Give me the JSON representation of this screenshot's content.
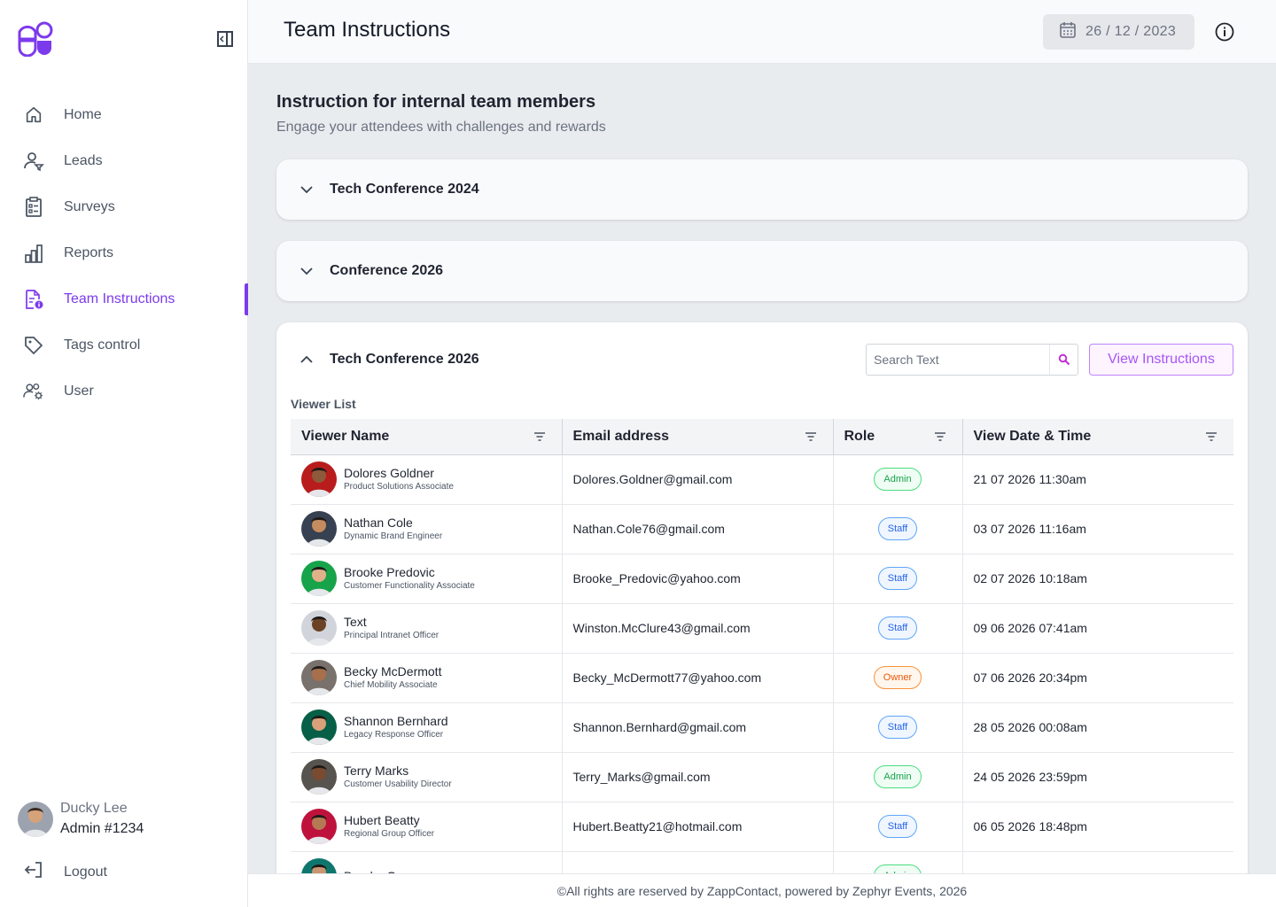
{
  "sidebar": {
    "items": [
      {
        "label": "Home",
        "icon": "home-icon"
      },
      {
        "label": "Leads",
        "icon": "leads-icon"
      },
      {
        "label": "Surveys",
        "icon": "clipboard-icon"
      },
      {
        "label": "Reports",
        "icon": "bar-chart-icon"
      },
      {
        "label": "Team Instructions",
        "icon": "document-info-icon",
        "active": true
      },
      {
        "label": "Tags control",
        "icon": "tag-icon"
      },
      {
        "label": "User",
        "icon": "users-gear-icon"
      }
    ],
    "user": {
      "name": "Ducky Lee",
      "role": "Admin #1234"
    },
    "logout_label": "Logout"
  },
  "header": {
    "title": "Team Instructions",
    "date": "26 / 12 / 2023"
  },
  "main": {
    "title": "Instruction for internal team members",
    "subtitle": "Engage your attendees with challenges and rewards",
    "accordions": [
      {
        "title": "Tech Conference 2024",
        "expanded": false
      },
      {
        "title": "Conference 2026",
        "expanded": false
      },
      {
        "title": "Tech Conference 2026",
        "expanded": true
      }
    ],
    "search": {
      "placeholder": "Search Text",
      "value": ""
    },
    "view_button_label": "View Instructions",
    "list_label": "Viewer List",
    "columns": [
      "Viewer Name",
      "Email address",
      "Role",
      "View Date & Time"
    ],
    "rows": [
      {
        "name": "Dolores Goldner",
        "title": "Product Solutions Associate",
        "email": "Dolores.Goldner@gmail.com",
        "role": "Admin",
        "datetime": "21 07 2026 11:30am"
      },
      {
        "name": "Nathan Cole",
        "title": "Dynamic Brand Engineer",
        "email": "Nathan.Cole76@gmail.com",
        "role": "Staff",
        "datetime": "03 07 2026 11:16am"
      },
      {
        "name": "Brooke Predovic",
        "title": "Customer Functionality Associate",
        "email": "Brooke_Predovic@yahoo.com",
        "role": "Staff",
        "datetime": "02 07 2026 10:18am"
      },
      {
        "name": "Text",
        "title": "Principal Intranet Officer",
        "email": "Winston.McClure43@gmail.com",
        "role": "Staff",
        "datetime": "09 06 2026 07:41am"
      },
      {
        "name": "Becky McDermott",
        "title": "Chief Mobility Associate",
        "email": "Becky_McDermott77@yahoo.com",
        "role": "Owner",
        "datetime": "07 06 2026 20:34pm"
      },
      {
        "name": "Shannon Bernhard",
        "title": "Legacy Response Officer",
        "email": "Shannon.Bernhard@gmail.com",
        "role": "Staff",
        "datetime": "28 05 2026 00:08am"
      },
      {
        "name": "Terry Marks",
        "title": "Customer Usability Director",
        "email": "Terry_Marks@gmail.com",
        "role": "Admin",
        "datetime": "24 05 2026 23:59pm"
      },
      {
        "name": "Hubert Beatty",
        "title": "Regional Group Officer",
        "email": "Hubert.Beatty21@hotmail.com",
        "role": "Staff",
        "datetime": "06 05 2026 18:48pm"
      },
      {
        "name": "Brooke Green",
        "title": "",
        "email": "",
        "role": "Admin",
        "datetime": ""
      }
    ]
  },
  "footer": {
    "text": "©All rights are reserved by ZappContact, powered by Zephyr Events, 2026"
  },
  "colors": {
    "accent": "#7c3aed",
    "admin": "#16a34a",
    "staff": "#2563eb",
    "owner": "#ea580c"
  }
}
